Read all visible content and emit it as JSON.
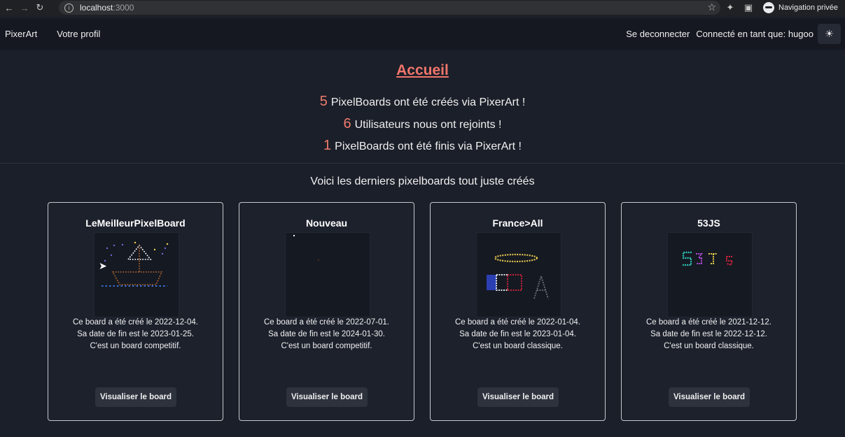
{
  "browser": {
    "url": "localhost",
    "url_port": ":3000",
    "profile_label": "Navigation privée"
  },
  "nav": {
    "brand": "PixerArt",
    "profile": "Votre profil",
    "logout": "Se deconnecter",
    "connected": "Connecté en tant que: hugoo"
  },
  "home": {
    "title": "Accueil",
    "stats": [
      {
        "num": "5",
        "text": "PixelBoards ont été créés via PixerArt !"
      },
      {
        "num": "6",
        "text": "Utilisateurs nous ont rejoints !"
      },
      {
        "num": "1",
        "text": "PixelBoards ont été finis via PixerArt !"
      }
    ],
    "subtitle": "Voici les derniers pixelboards tout juste créés"
  },
  "boards": [
    {
      "name": "LeMeilleurPixelBoard",
      "created": "Ce board a été créé le 2022-12-04.",
      "end": "Sa date de fin est le 2023-01-25.",
      "type": "C'est un board competitif.",
      "button": "Visualiser le board"
    },
    {
      "name": "Nouveau",
      "created": "Ce board a été créé le 2022-07-01.",
      "end": "Sa date de fin est le 2024-01-30.",
      "type": "C'est un board competitif.",
      "button": "Visualiser le board"
    },
    {
      "name": "France>All",
      "created": "Ce board a été créé le 2022-01-04.",
      "end": "Sa date de fin est le 2023-01-04.",
      "type": "C'est un board classique.",
      "button": "Visualiser le board"
    },
    {
      "name": "53JS",
      "created": "Ce board a été créé le 2021-12-12.",
      "end": "Sa date de fin est le 2022-12-12.",
      "type": "C'est un board classique.",
      "button": "Visualiser le board"
    }
  ],
  "colors": {
    "accent": "#f0756b",
    "background": "#1b1f29",
    "navbar": "#151821"
  }
}
